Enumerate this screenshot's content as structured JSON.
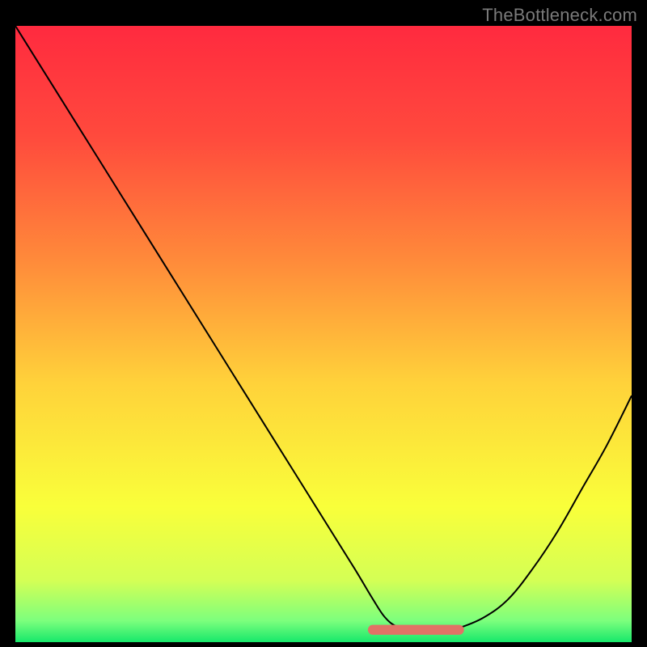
{
  "watermark": "TheBottleneck.com",
  "chart_data": {
    "type": "line",
    "title": "",
    "xlabel": "",
    "ylabel": "",
    "xlim": [
      0,
      100
    ],
    "ylim": [
      0,
      100
    ],
    "grid": false,
    "legend": false,
    "background_gradient": {
      "stops": [
        {
          "offset": 0,
          "color": "#ff2a3f"
        },
        {
          "offset": 0.18,
          "color": "#ff4a3d"
        },
        {
          "offset": 0.38,
          "color": "#ff8a3a"
        },
        {
          "offset": 0.58,
          "color": "#ffd23a"
        },
        {
          "offset": 0.78,
          "color": "#f9ff3a"
        },
        {
          "offset": 0.9,
          "color": "#d4ff55"
        },
        {
          "offset": 0.965,
          "color": "#7dff7d"
        },
        {
          "offset": 1.0,
          "color": "#17e86b"
        }
      ]
    },
    "series": [
      {
        "name": "bottleneck-curve",
        "stroke": "#000000",
        "stroke_width": 2,
        "x": [
          0,
          5,
          10,
          15,
          20,
          25,
          30,
          35,
          40,
          45,
          50,
          55,
          58,
          60,
          62,
          65,
          68,
          70,
          72,
          76,
          80,
          84,
          88,
          92,
          96,
          100
        ],
        "y": [
          100,
          92,
          84,
          76,
          68,
          60,
          52,
          44,
          36,
          28,
          20,
          12,
          7,
          4,
          2.5,
          1.8,
          1.8,
          1.9,
          2.3,
          4,
          7,
          12,
          18,
          25,
          32,
          40
        ]
      }
    ],
    "highlight_band": {
      "name": "optimal-range",
      "color": "#e17366",
      "x_start": 58,
      "x_end": 72,
      "y": 2,
      "thickness": 1.6
    }
  }
}
